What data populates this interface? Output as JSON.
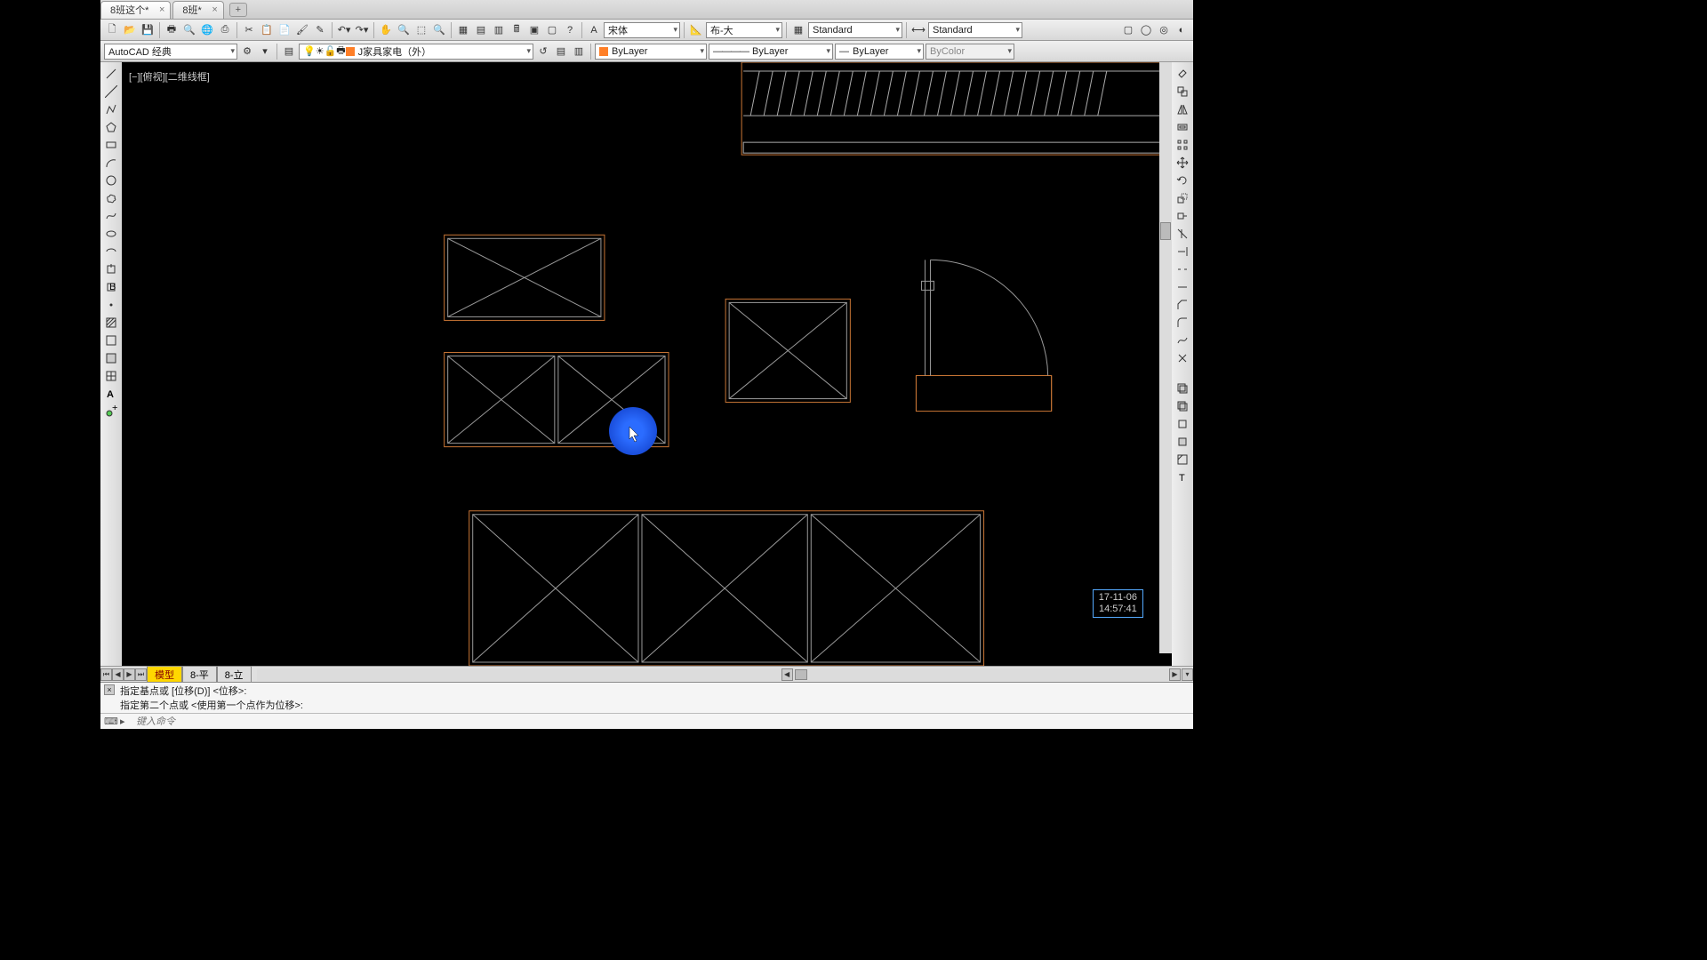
{
  "tabs": {
    "items": [
      {
        "label": "8班这个*",
        "active": true
      },
      {
        "label": "8班*",
        "active": false
      }
    ]
  },
  "toolbar1": {
    "font_dd": "宋体",
    "annostyle_dd": "布-大",
    "textstyle_dd": "Standard",
    "dimstyle_dd": "Standard"
  },
  "toolbar2": {
    "workspace_dd": "AutoCAD 经典",
    "layer_dd": "J家具家电（外）",
    "layer_color": "#ff7f27",
    "color_dd": "ByLayer",
    "color_sw": "#ff7f27",
    "linetype_dd": "ByLayer",
    "lineweight_dd": "ByLayer",
    "plotstyle_dd": "ByColor"
  },
  "canvas": {
    "view_label": "[−][俯视][二维线框]",
    "highlight_color": "#2b6cff"
  },
  "timestamp": {
    "date": "17-11-06",
    "time": "14:57:41"
  },
  "layout_tabs": {
    "model": "模型",
    "items": [
      "8-平",
      "8-立"
    ]
  },
  "command": {
    "hist1": "指定基点或 [位移(D)] <位移>:",
    "hist2": "指定第二个点或 <使用第一个点作为位移>:",
    "placeholder": "键入命令"
  }
}
